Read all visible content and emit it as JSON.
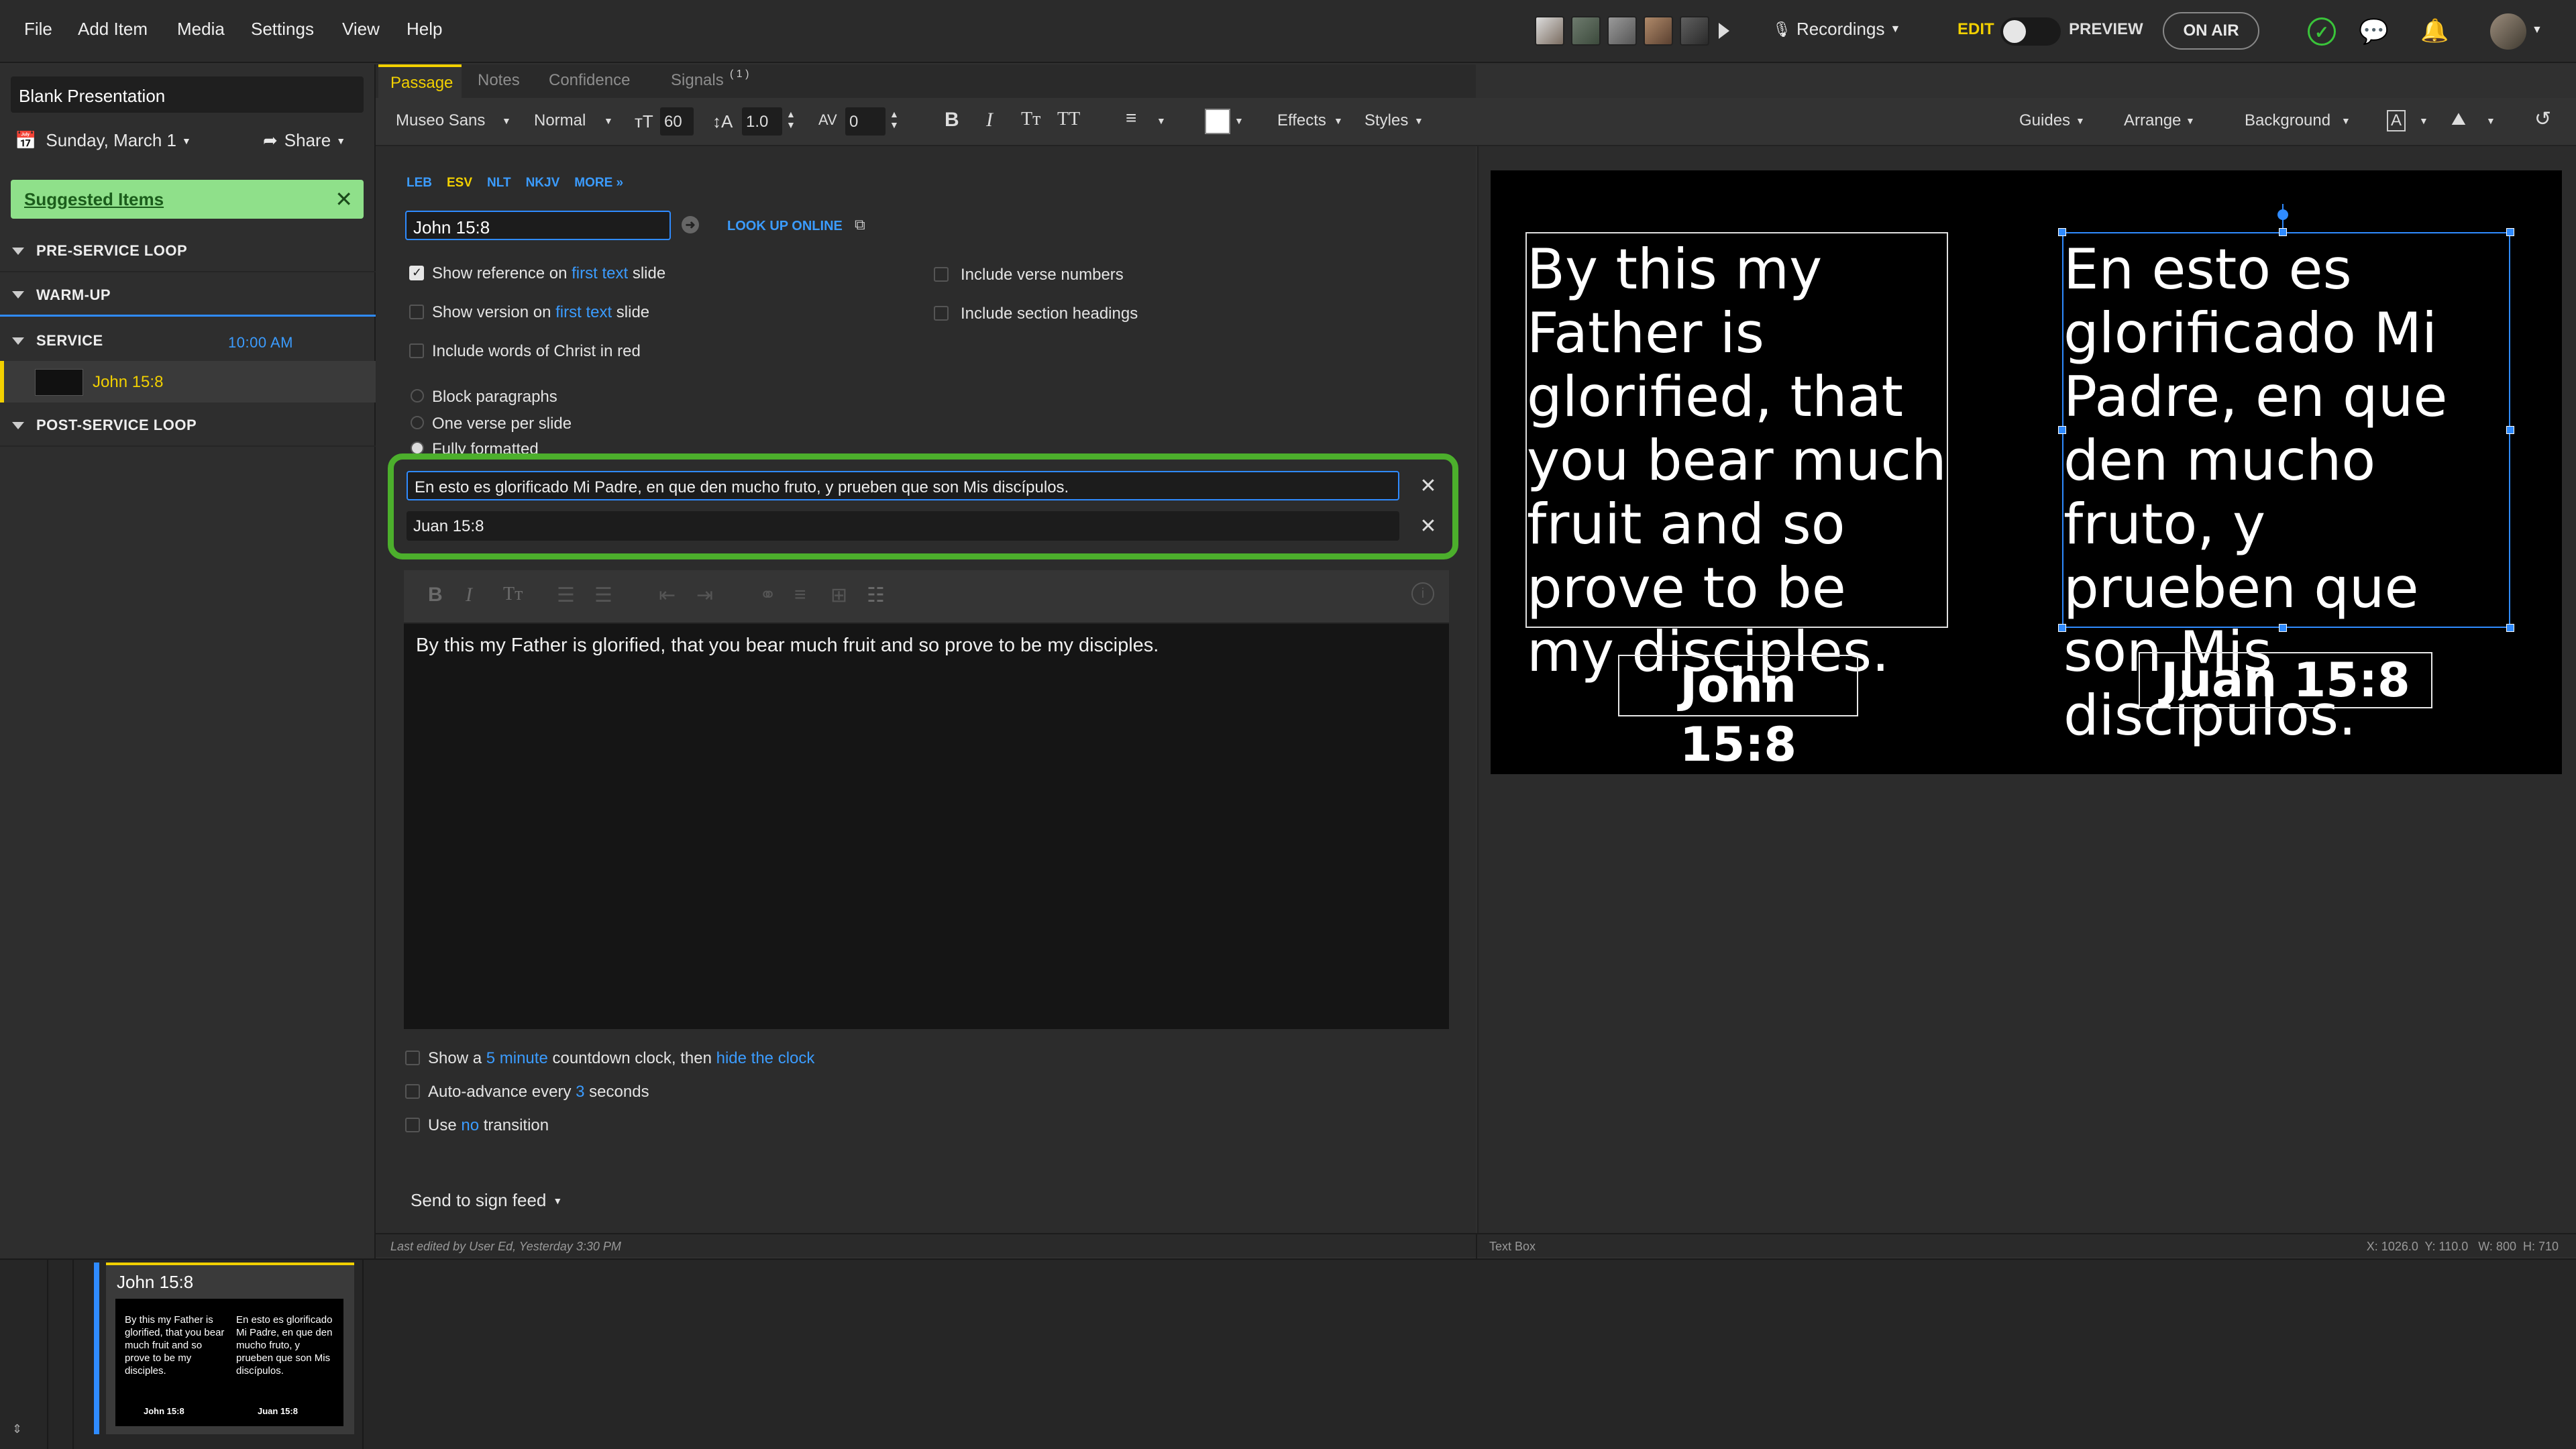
{
  "menu": {
    "file": "File",
    "add_item": "Add Item",
    "media": "Media",
    "settings": "Settings",
    "view": "View",
    "help": "Help"
  },
  "header": {
    "recordings": "Recordings",
    "edit": "EDIT",
    "preview": "PREVIEW",
    "on_air": "ON AIR",
    "edit_mode_on": false
  },
  "sidebar": {
    "presentation_title": "Blank Presentation",
    "date": "Sunday, March 1",
    "share": "Share",
    "suggested": "Suggested Items",
    "sections": [
      {
        "label": "PRE-SERVICE LOOP",
        "time": ""
      },
      {
        "label": "WARM-UP",
        "time": ""
      },
      {
        "label": "SERVICE",
        "time": "10:00 AM"
      },
      {
        "label": "POST-SERVICE LOOP",
        "time": ""
      }
    ],
    "active_item": "John 15:8"
  },
  "tabs": {
    "passage": "Passage",
    "notes": "Notes",
    "confidence": "Confidence",
    "signals": "Signals",
    "signals_badge": "( 1 )"
  },
  "toolbar": {
    "font": "Museo Sans",
    "weight": "Normal",
    "size": "60",
    "line_height": "1.0",
    "tracking": "0",
    "effects": "Effects",
    "styles": "Styles",
    "guides": "Guides",
    "arrange": "Arrange",
    "background": "Background",
    "fill_color": "#ffffff"
  },
  "passage": {
    "versions": [
      "LEB",
      "ESV",
      "NLT",
      "NKJV",
      "MORE »"
    ],
    "active_version": "ESV",
    "reference": "John 15:8",
    "lookup": "LOOK UP ONLINE",
    "opt_show_ref": "Show reference on",
    "opt_show_ver": "Show version on",
    "first_text": "first text",
    "slide": "slide",
    "opt_red": "Include words of Christ in red",
    "opt_verse_numbers": "Include verse numbers",
    "opt_section_headings": "Include section headings",
    "radio_block": "Block paragraphs",
    "radio_verse": "One verse per slide",
    "radio_full": "Fully formatted",
    "translation_text": "En esto es glorificado Mi Padre, en que den mucho fruto, y prueben que son Mis discípulos.",
    "translation_ref": "Juan 15:8",
    "body_text": "By this my Father is glorified, that you bear much fruit and so prove to be my disciples.",
    "countdown": {
      "a": "Show a",
      "b": "5 minute",
      "c": "countdown clock, then",
      "d": "hide the clock"
    },
    "advance": {
      "a": "Auto-advance every",
      "b": "3",
      "c": "seconds"
    },
    "transition": {
      "a": "Use",
      "b": "no",
      "c": "transition"
    },
    "sign_feed": "Send to sign feed"
  },
  "slide": {
    "english": "By this my Father is glorified, that you bear much fruit and so prove to be my disciples.",
    "english_ref": "John 15:8",
    "spanish": "En esto es glorificado Mi Padre, en que den mucho fruto, y prueben que son Mis discípulos.",
    "spanish_ref": "Juan 15:8"
  },
  "status": {
    "last_edited": "Last edited by User Ed, Yesterday 3:30 PM",
    "selection": "Text Box",
    "coords": "X: 1026.0  Y: 110.0   W: 800  H: 710"
  },
  "thumb": {
    "title": "John 15:8",
    "en": "By this my Father is glorified, that you bear much fruit and so prove to be my disciples.",
    "en_ref": "John 15:8",
    "es": "En esto es glorificado Mi Padre, en que den mucho fruto, y prueben que son Mis discípulos.",
    "es_ref": "Juan 15:8"
  }
}
